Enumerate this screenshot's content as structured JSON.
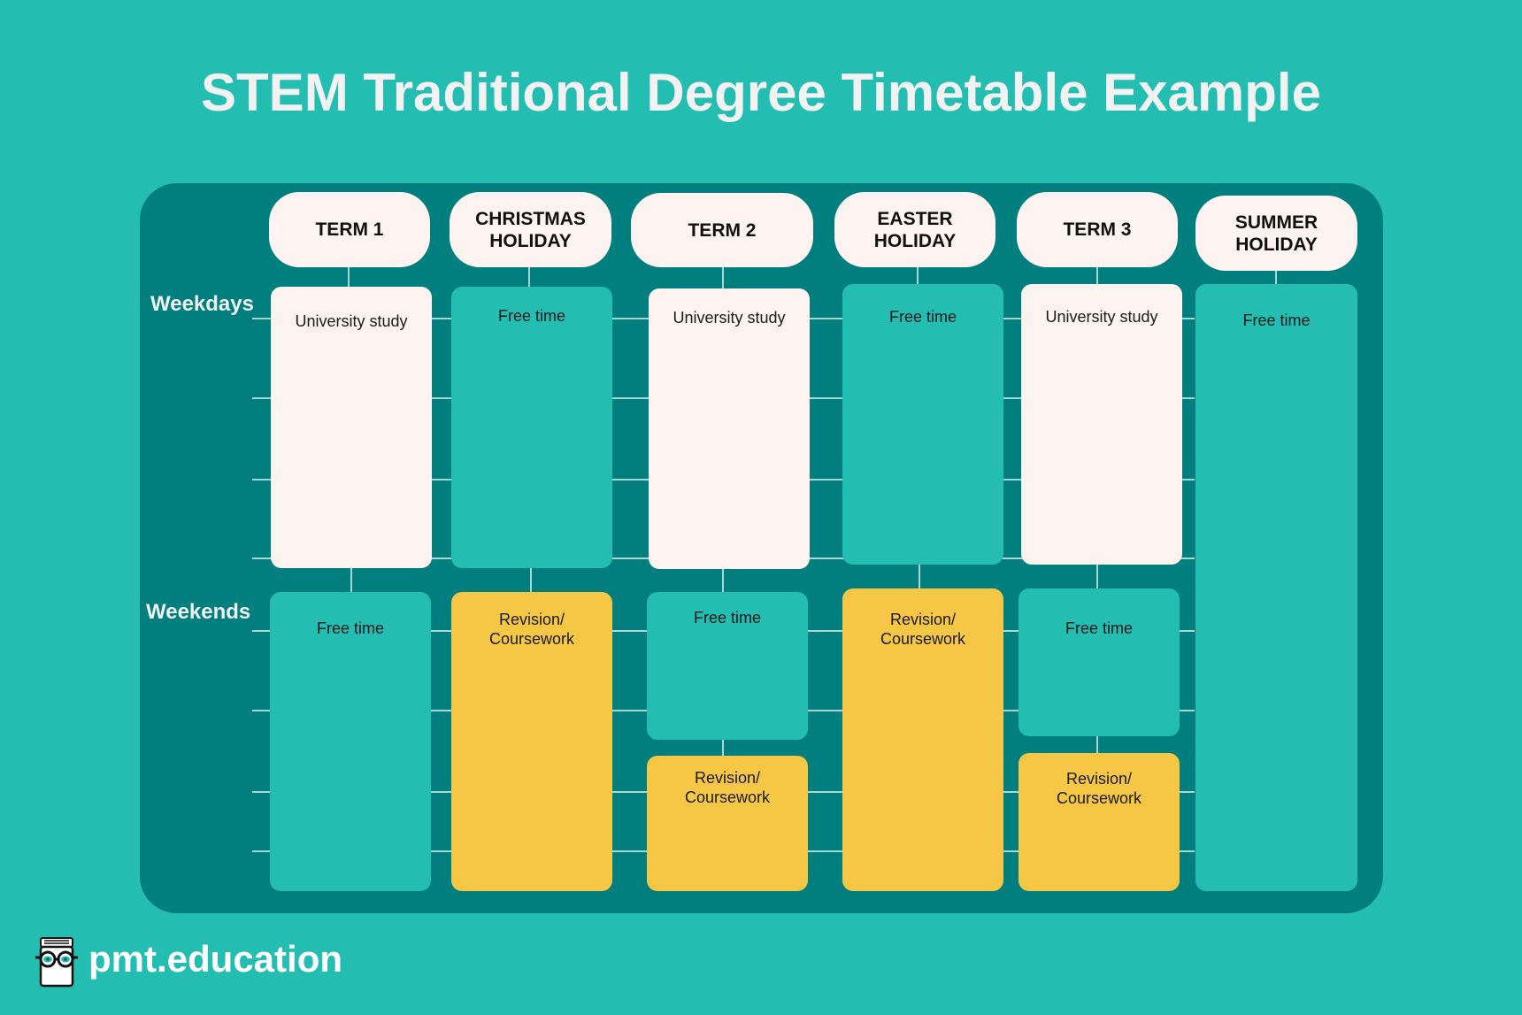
{
  "title": "STEM Traditional Degree Timetable Example",
  "row_labels": {
    "weekdays": "Weekdays",
    "weekends": "Weekends"
  },
  "columns": [
    {
      "header": "TERM 1",
      "weekdays": "University study",
      "weekends": [
        "Free time"
      ]
    },
    {
      "header": "CHRISTMAS\nHOLIDAY",
      "weekdays": "Free time",
      "weekends": [
        "Revision/\nCoursework"
      ]
    },
    {
      "header": "TERM 2",
      "weekdays": "University study",
      "weekends": [
        "Free time",
        "Revision/\nCoursework"
      ]
    },
    {
      "header": "EASTER\nHOLIDAY",
      "weekdays": "Free time",
      "weekends": [
        "Revision/\nCoursework"
      ]
    },
    {
      "header": "TERM 3",
      "weekdays": "University study",
      "weekends": [
        "Free time",
        "Revision/\nCoursework"
      ]
    },
    {
      "header": "SUMMER\nHOLIDAY",
      "all_week": "Free time"
    }
  ],
  "colors": {
    "background": "#23bdb1",
    "panel": "#017f7e",
    "university_study": "#fdf4f1",
    "free_time": "#23bdb1",
    "revision_coursework": "#f5c744"
  },
  "brand": {
    "logo_icon": "book-with-glasses-icon",
    "name": "pmt.education"
  }
}
